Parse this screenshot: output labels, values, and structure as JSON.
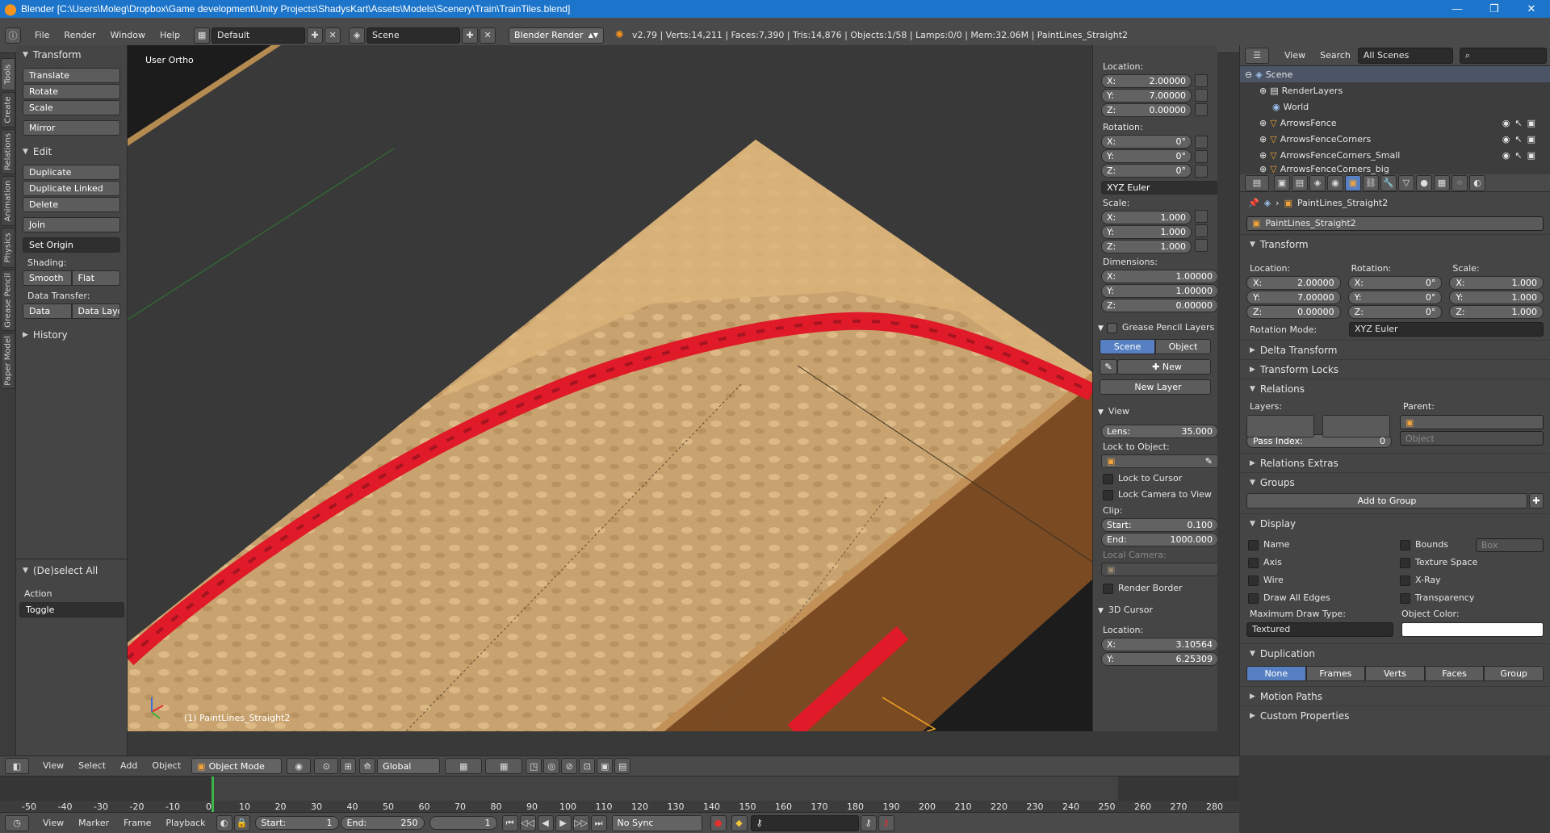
{
  "window": {
    "title": "Blender [C:\\Users\\Moleg\\Dropbox\\Game development\\Unity Projects\\ShadysKart\\Assets\\Models\\Scenery\\Train\\TrainTiles.blend]",
    "app_icon": "blender-icon",
    "controls": {
      "minimize": "—",
      "maximize": "❐",
      "close": "✕"
    }
  },
  "info_header": {
    "menus": [
      "File",
      "Render",
      "Window",
      "Help"
    ],
    "layout": "Default",
    "scene": "Scene",
    "engine": "Blender Render",
    "stats": "v2.79 | Verts:14,211 | Faces:7,390 | Tris:14,876 | Objects:1/58 | Lamps:0/0 | Mem:32.06M | PaintLines_Straight2"
  },
  "tool_tabs": [
    "Tools",
    "Create",
    "Relations",
    "Animation",
    "Physics",
    "Grease Pencil",
    "Paper Model"
  ],
  "toolshelf": {
    "transform": {
      "title": "Transform",
      "buttons": [
        "Translate",
        "Rotate",
        "Scale",
        "Mirror"
      ]
    },
    "edit": {
      "title": "Edit",
      "buttons": [
        "Duplicate",
        "Duplicate Linked",
        "Delete",
        "Join",
        "Set Origin"
      ],
      "shading_label": "Shading:",
      "shading": [
        "Smooth",
        "Flat"
      ],
      "data_transfer_label": "Data Transfer:",
      "data_transfer": [
        "Data",
        "Data Layo"
      ]
    },
    "history": "History",
    "operator": {
      "title": "(De)select All",
      "action_label": "Action",
      "action_value": "Toggle"
    }
  },
  "viewport": {
    "view_name": "User Ortho",
    "object_label": "(1) PaintLines_Straight2"
  },
  "npanel": {
    "location_label": "Location:",
    "location": [
      {
        "k": "X:",
        "v": "2.00000"
      },
      {
        "k": "Y:",
        "v": "7.00000"
      },
      {
        "k": "Z:",
        "v": "0.00000"
      }
    ],
    "rotation_label": "Rotation:",
    "rotation": [
      {
        "k": "X:",
        "v": "0°"
      },
      {
        "k": "Y:",
        "v": "0°"
      },
      {
        "k": "Z:",
        "v": "0°"
      }
    ],
    "rotation_mode": "XYZ Euler",
    "scale_label": "Scale:",
    "scale": [
      {
        "k": "X:",
        "v": "1.000"
      },
      {
        "k": "Y:",
        "v": "1.000"
      },
      {
        "k": "Z:",
        "v": "1.000"
      }
    ],
    "dimensions_label": "Dimensions:",
    "dimensions": [
      {
        "k": "X:",
        "v": "1.00000"
      },
      {
        "k": "Y:",
        "v": "1.00000"
      },
      {
        "k": "Z:",
        "v": "0.00000"
      }
    ],
    "grease_pencil": {
      "title": "Grease Pencil Layers",
      "scene": "Scene",
      "object": "Object",
      "new": "New",
      "new_layer": "New Layer"
    },
    "view": {
      "title": "View",
      "lens_label": "Lens:",
      "lens": "35.000",
      "lock_object_label": "Lock to Object:",
      "lock_cursor": "Lock to Cursor",
      "lock_camera": "Lock Camera to View",
      "clip_label": "Clip:",
      "clip_start_label": "Start:",
      "clip_start": "0.100",
      "clip_end_label": "End:",
      "clip_end": "1000.000",
      "local_camera_label": "Local Camera:",
      "render_border": "Render Border"
    },
    "cursor": {
      "title": "3D Cursor",
      "location_label": "Location:",
      "x_label": "X:",
      "x": "3.10564",
      "y_label": "Y:",
      "y": "6.25309"
    }
  },
  "outliner": {
    "menus": [
      "View",
      "Search"
    ],
    "filter": "All Scenes",
    "rows": [
      {
        "label": "Scene",
        "icon": "scene-icon"
      },
      {
        "label": "RenderLayers",
        "icon": "renderlayers-icon"
      },
      {
        "label": "World",
        "icon": "world-icon"
      },
      {
        "label": "ArrowsFence",
        "icon": "mesh-icon"
      },
      {
        "label": "ArrowsFenceCorners",
        "icon": "mesh-icon"
      },
      {
        "label": "ArrowsFenceCorners_Small",
        "icon": "mesh-icon"
      },
      {
        "label": "ArrowsFenceCorners_big",
        "icon": "mesh-icon"
      }
    ]
  },
  "properties": {
    "breadcrumb": "PaintLines_Straight2",
    "object_name": "PaintLines_Straight2",
    "transform": {
      "title": "Transform",
      "location_label": "Location:",
      "rotation_label": "Rotation:",
      "scale_label": "Scale:",
      "location": [
        {
          "k": "X:",
          "v": "2.00000"
        },
        {
          "k": "Y:",
          "v": "7.00000"
        },
        {
          "k": "Z:",
          "v": "0.00000"
        }
      ],
      "rotation": [
        {
          "k": "X:",
          "v": "0°"
        },
        {
          "k": "Y:",
          "v": "0°"
        },
        {
          "k": "Z:",
          "v": "0°"
        }
      ],
      "scale": [
        {
          "k": "X:",
          "v": "1.000"
        },
        {
          "k": "Y:",
          "v": "1.000"
        },
        {
          "k": "Z:",
          "v": "1.000"
        }
      ],
      "rotation_mode_label": "Rotation Mode:",
      "rotation_mode": "XYZ Euler"
    },
    "delta_transform": "Delta Transform",
    "transform_locks": "Transform Locks",
    "relations": {
      "title": "Relations",
      "layers_label": "Layers:",
      "parent_label": "Parent:",
      "parent_type": "Object",
      "pass_index_label": "Pass Index:",
      "pass_index": "0"
    },
    "relations_extras": "Relations Extras",
    "groups": {
      "title": "Groups",
      "add": "Add to Group"
    },
    "display": {
      "title": "Display",
      "left": [
        "Name",
        "Axis",
        "Wire",
        "Draw All Edges"
      ],
      "right": [
        "Bounds",
        "Texture Space",
        "X-Ray",
        "Transparency"
      ],
      "bounds_type": "Box",
      "max_draw_label": "Maximum Draw Type:",
      "max_draw": "Textured",
      "color_label": "Object Color:"
    },
    "duplication": {
      "title": "Duplication",
      "options": [
        "None",
        "Frames",
        "Verts",
        "Faces",
        "Group"
      ]
    },
    "motion_paths": "Motion Paths",
    "custom_properties": "Custom Properties"
  },
  "viewport_header": {
    "menus": [
      "View",
      "Select",
      "Add",
      "Object"
    ],
    "mode": "Object Mode",
    "orientation": "Global"
  },
  "timeline": {
    "ruler": [
      "-50",
      "-40",
      "-30",
      "-20",
      "-10",
      "0",
      "10",
      "20",
      "30",
      "40",
      "50",
      "60",
      "70",
      "80",
      "90",
      "100",
      "110",
      "120",
      "130",
      "140",
      "150",
      "160",
      "170",
      "180",
      "190",
      "200",
      "210",
      "220",
      "230",
      "240",
      "250",
      "260",
      "270",
      "280"
    ],
    "menus": [
      "View",
      "Marker",
      "Frame",
      "Playback"
    ],
    "start_label": "Start:",
    "start": "1",
    "end_label": "End:",
    "end": "250",
    "current": "1",
    "sync": "No Sync"
  },
  "colors": {
    "title_bar": "#1c75ca",
    "ui_bg": "#454545",
    "viewport_bg": "#393939",
    "selected_tab": "#5680c2",
    "sand": "#c9a36f",
    "paint_red": "#e01a28",
    "dirt_side": "#7a4a22",
    "current_frame": "#3eb34a"
  }
}
